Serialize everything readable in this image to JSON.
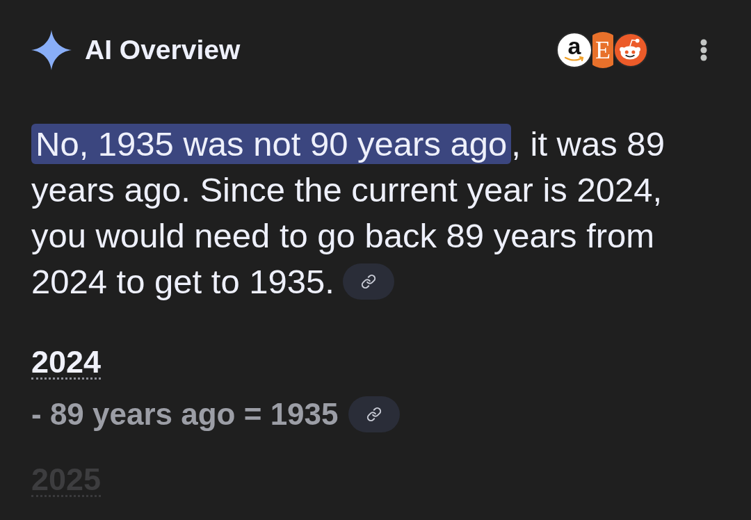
{
  "header": {
    "title": "AI Overview",
    "sources": [
      {
        "kind": "wordmark",
        "letter": "a",
        "color": "#ffffff"
      },
      {
        "kind": "serif",
        "letter": "E",
        "color": "#e8712b"
      },
      {
        "kind": "mascot",
        "color": "#ec5b29"
      }
    ]
  },
  "answer": {
    "highlighted": "No, 1935 was not 90 years ago",
    "text": ", it was 89 years ago. Since the current year is 2024, you would need to go back 89 years from 2024 to get to 1935.",
    "source_link": true
  },
  "sections": [
    {
      "heading": "2024",
      "faded": false,
      "lines": [
        {
          "text": "- 89 years ago = 1935",
          "source_link": true
        }
      ]
    },
    {
      "heading": "2025",
      "faded": true
    }
  ]
}
